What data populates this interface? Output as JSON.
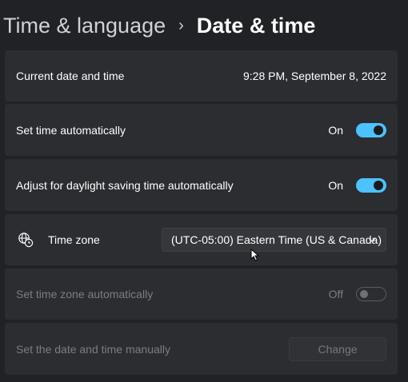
{
  "breadcrumb": {
    "parent": "Time & language",
    "separator": "›",
    "current": "Date & time"
  },
  "current_datetime": {
    "label": "Current date and time",
    "value": "9:28 PM, September 8, 2022"
  },
  "set_time_auto": {
    "label": "Set time automatically",
    "state": "On",
    "enabled": true
  },
  "daylight_saving": {
    "label": "Adjust for daylight saving time automatically",
    "state": "On",
    "enabled": true
  },
  "time_zone": {
    "icon": "globe-clock-icon",
    "label": "Time zone",
    "selected": "(UTC-05:00) Eastern Time (US & Canada)"
  },
  "set_timezone_auto": {
    "label": "Set time zone automatically",
    "state": "Off",
    "enabled": false
  },
  "manual": {
    "label": "Set the date and time manually",
    "button": "Change",
    "enabled": false
  },
  "colors": {
    "accent": "#4cc2ff",
    "background": "#202226",
    "card": "#2b2d31",
    "disabled_text": "#7b7d81"
  }
}
